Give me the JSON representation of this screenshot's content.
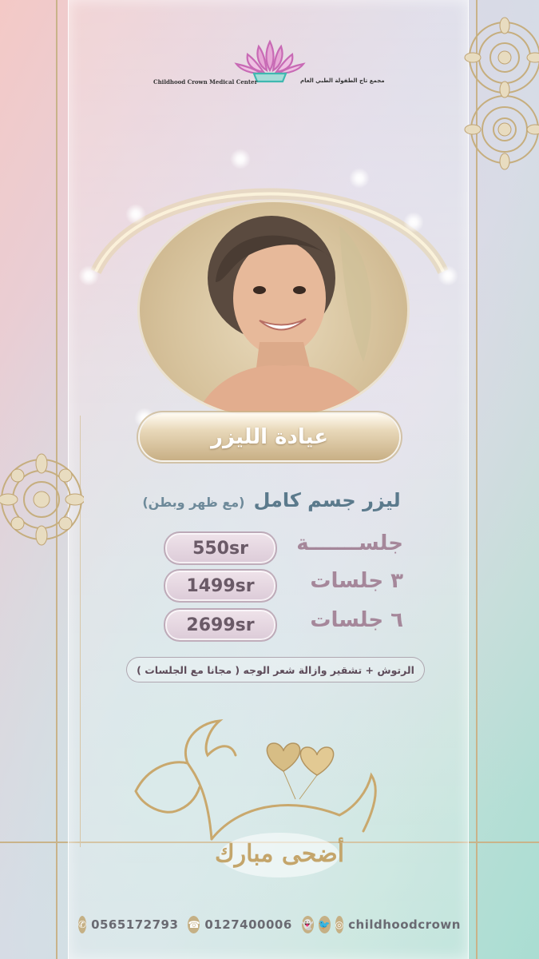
{
  "brand": {
    "name_en": "Childhood Crown Medical Center",
    "name_ar": "مجمع تاج الطفولة الطبي العام"
  },
  "title": "عيادة الليزر",
  "offer": {
    "main": "ليزر جسم كامل",
    "detail": "(مع ظهر وبطن)"
  },
  "prices": [
    {
      "label": "جلســـــــة",
      "price": "550sr"
    },
    {
      "label": "٣ جلسات",
      "price": "1499sr"
    },
    {
      "label": "٦ جلسات",
      "price": "2699sr"
    }
  ],
  "note": "الرتوش + تشقير وازالة شعر الوجه ( مجانا مع الجلسات )",
  "greeting": "أضحى مبارك",
  "footer": {
    "whatsapp": "0565172793",
    "phone": "0127400006",
    "handle": "childhoodcrown",
    "icons": [
      "whatsapp-icon",
      "phone-icon",
      "snapchat-icon",
      "twitter-icon",
      "instagram-icon"
    ]
  },
  "colors": {
    "gold": "#c9b38a",
    "title_text": "#ffffff",
    "offer_text": "#5b7a8c",
    "label_text": "#a5879a",
    "logo_pink": "#c86ab5",
    "logo_teal": "#3fb8b0"
  }
}
